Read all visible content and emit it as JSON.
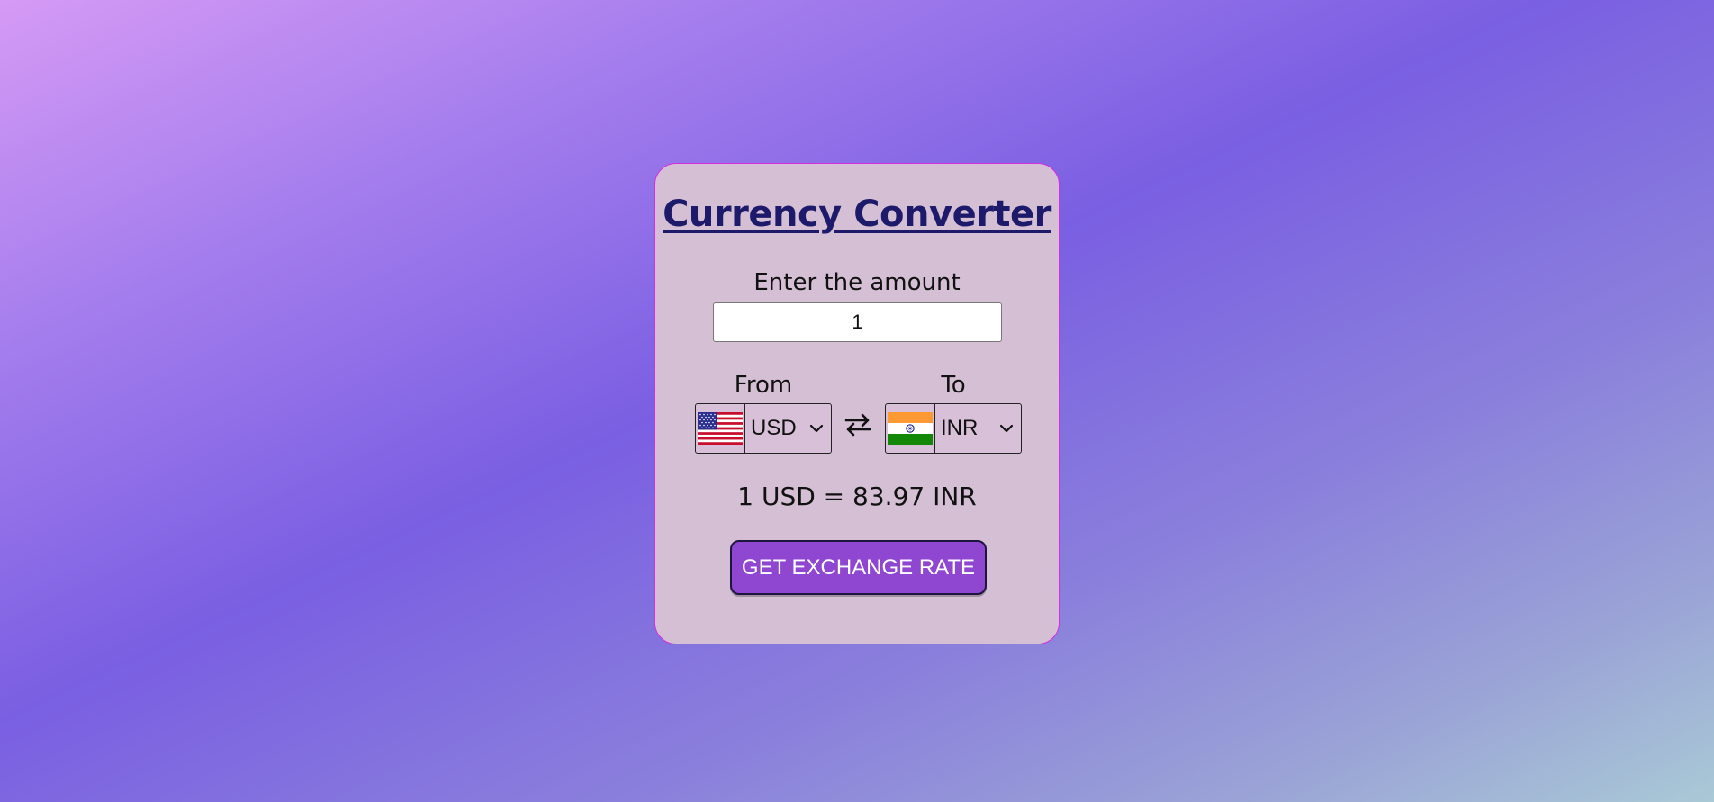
{
  "app": {
    "title": "Currency Converter"
  },
  "amount": {
    "label": "Enter the amount",
    "value": "1"
  },
  "from": {
    "label": "From",
    "currency": "USD",
    "flag_icon": "us-flag-icon"
  },
  "to": {
    "label": "To",
    "currency": "INR",
    "flag_icon": "india-flag-icon"
  },
  "swap_icon": "swap-arrows-icon",
  "result": {
    "text": "1 USD = 83.97 INR"
  },
  "button": {
    "label": "GET EXCHANGE RATE"
  },
  "colors": {
    "title": "#1e1a6b",
    "card_background": "#d5bfd4",
    "card_border": "#d12fe0",
    "button_background": "#8f46d0",
    "button_text": "#ffffff"
  }
}
